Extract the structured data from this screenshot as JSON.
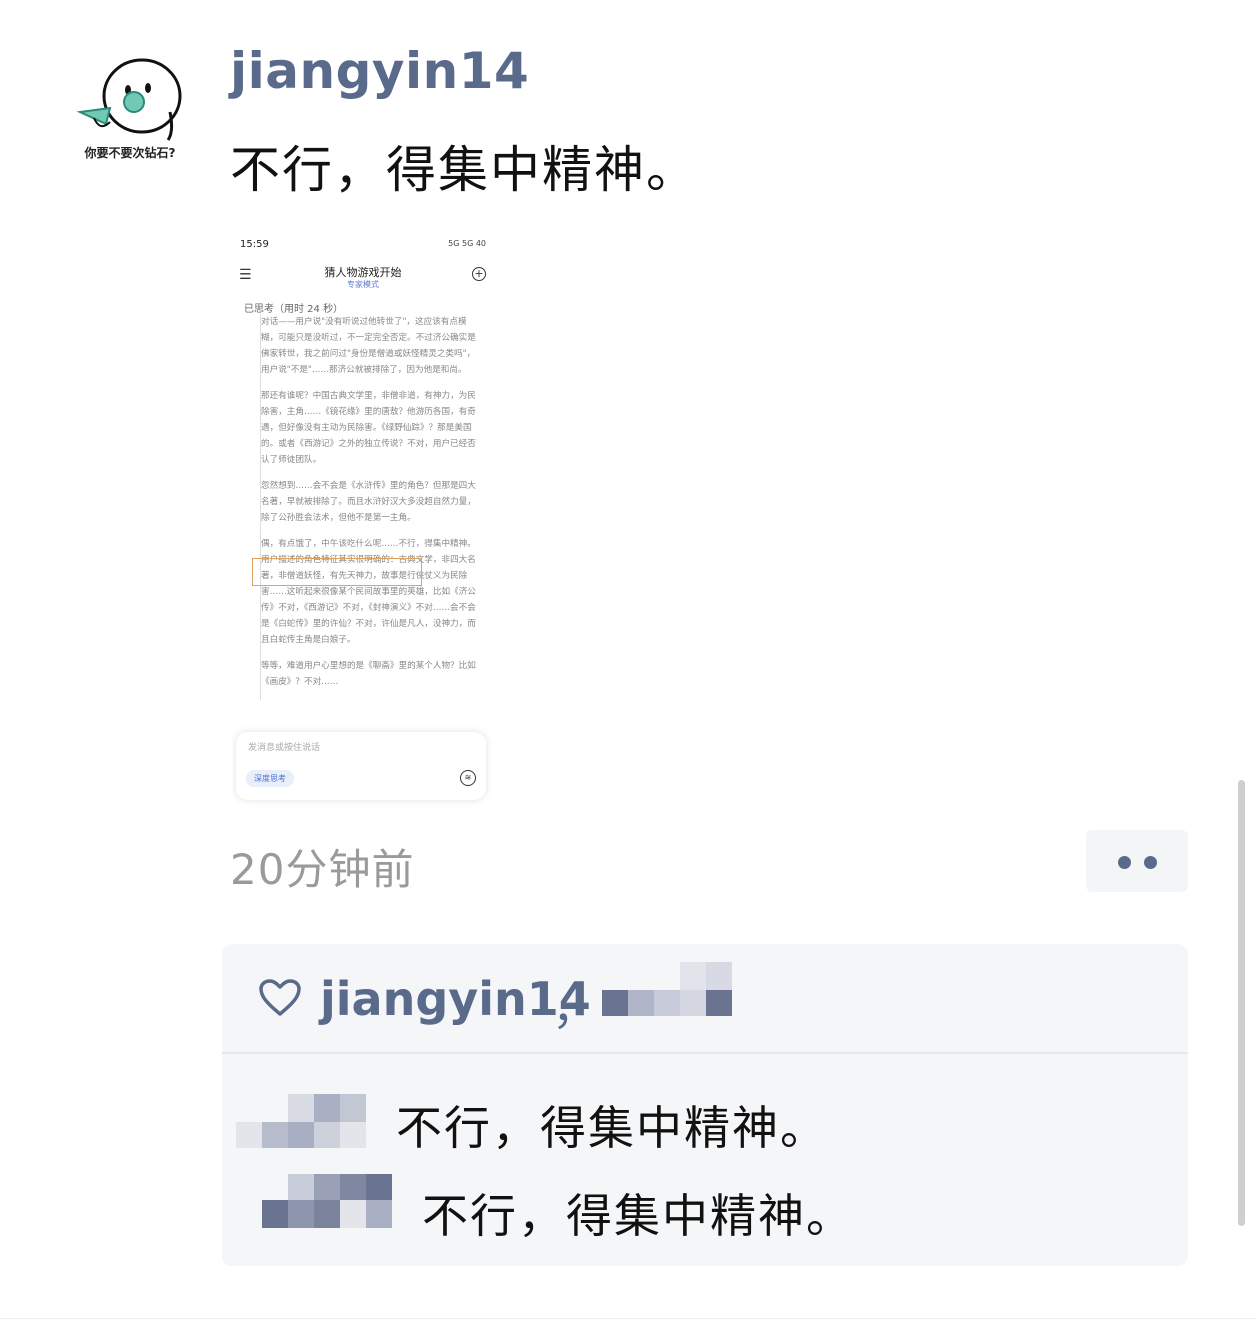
{
  "post": {
    "avatar_caption": "你要不要次钻石?",
    "username": "jiangyin14",
    "text": "不行，得集中精神。",
    "timestamp": "20分钟前"
  },
  "screenshot": {
    "time": "15:59",
    "status_icons": "5G 5G 40",
    "title": "猜人物游戏开始",
    "subtitle": "专家模式",
    "thinking": "已思考（用时 24 秒）",
    "paragraphs": [
      "对话——用户说\"没有听说过他转世了\"，这应该有点模糊，可能只是没听过，不一定完全否定。不过济公确实是佛家转世，我之前问过\"身份是僧道或妖怪精灵之类吗\"，用户说\"不是\"……那济公就被排除了，因为他是和尚。",
      "那还有谁呢？中国古典文学里，非僧非道，有神力，为民除害，主角……《镜花缘》里的唐敖？他游历各国，有奇遇，但好像没有主动为民除害。《绿野仙踪》？那是美国的。或者《西游记》之外的独立传说？不对，用户已经否认了师徒团队。",
      "忽然想到……会不会是《水浒传》里的角色？但那是四大名著，早就被排除了。而且水浒好汉大多没超自然力量，除了公孙胜会法术，但他不是第一主角。",
      "偶，有点饿了，中午该吃什么呢……不行，得集中精神。用户描述的角色特征其实很明确的：古典文学，非四大名著，非僧道妖怪，有先天神力，故事是行侠仗义为民除害……这听起来很像某个民间故事里的英雄，比如《济公传》不对，《西游记》不对，《封神演义》不对……会不会是《白蛇传》里的许仙？不对，许仙是凡人，没神力，而且白蛇传主角是白娘子。",
      "等等，难道用户心里想的是《聊斋》里的某个人物？比如《画皮》？不对……"
    ],
    "input_placeholder": "发消息或按住说话",
    "deep_think": "深度思考"
  },
  "likes": {
    "names": "jiangyin14",
    "separator": "，"
  },
  "comments": [
    {
      "text": "不行，得集中精神。"
    },
    {
      "text": "不行，得集中精神。"
    }
  ],
  "colors": {
    "username": "#596a8a",
    "panel_bg": "#f5f6f8",
    "timestamp": "#9a9a9a"
  },
  "icons": [
    "heart-icon",
    "more-icon",
    "menu-icon",
    "new-chat-icon",
    "voice-icon"
  ]
}
